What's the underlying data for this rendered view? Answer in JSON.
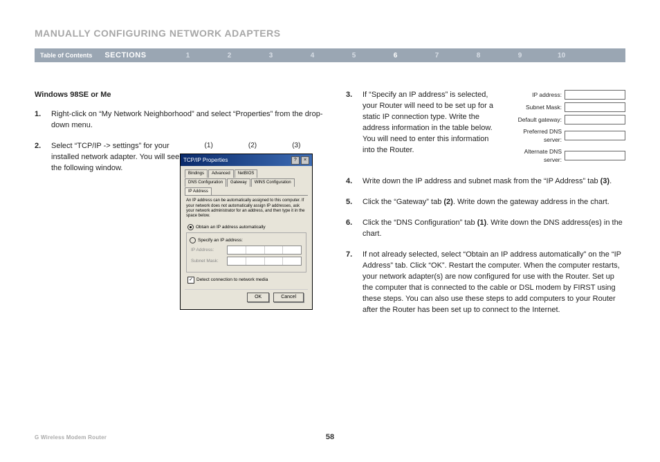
{
  "page": {
    "title": "MANUALLY CONFIGURING NETWORK ADAPTERS",
    "footer_left": "G Wireless Modem Router",
    "page_number": "58"
  },
  "nav": {
    "toc": "Table of Contents",
    "sections_label": "SECTIONS",
    "numbers": [
      "1",
      "2",
      "3",
      "4",
      "5",
      "6",
      "7",
      "8",
      "9",
      "10"
    ],
    "active": "6"
  },
  "subhead": "Windows 98SE or Me",
  "steps_left": {
    "1": "Right-click on “My Network Neighborhood” and select “Properties” from the drop-down menu.",
    "2": "Select “TCP/IP -> settings” for your installed network adapter. You will see the following window."
  },
  "markers": {
    "m1": "(1)",
    "m2": "(2)",
    "m3": "(3)"
  },
  "dialog": {
    "title": "TCP/IP Properties",
    "tabs_top": [
      "Bindings",
      "Advanced",
      "NetBIOS"
    ],
    "tabs_bottom": [
      "DNS Configuration",
      "Gateway",
      "WINS Configuration",
      "IP Address"
    ],
    "desc": "An IP address can be automatically assigned to this computer. If your network does not automatically assign IP addresses, ask your network administrator for an address, and then type it in the space below.",
    "radio_auto": "Obtain an IP address automatically",
    "radio_specify": "Specify an IP address:",
    "lbl_ip": "IP Address:",
    "lbl_mask": "Subnet Mask:",
    "chk_detect": "Detect connection to network media",
    "btn_ok": "OK",
    "btn_cancel": "Cancel"
  },
  "steps_right": {
    "3": "If “Specify an IP address” is selected, your Router will need to be set up for a static IP connection type. Write the address information in the table below. You will need to enter this information into the Router.",
    "4_pre": "Write down the IP address and subnet mask from the “IP Address” tab ",
    "4_bold": "(3)",
    "4_post": ".",
    "5_pre": "Click the “Gateway” tab ",
    "5_bold": "(2)",
    "5_post": ". Write down the gateway address in the chart.",
    "6_pre": "Click the “DNS Configuration” tab ",
    "6_bold": "(1)",
    "6_post": ". Write down the DNS address(es) in the chart.",
    "7": "If not already selected, select “Obtain an IP address automatically” on the “IP Address” tab. Click “OK”. Restart the computer. When the computer restarts, your network adapter(s) are now configured for use with the Router. Set up the computer that is connected to the cable or DSL modem by FIRST using these steps. You can also use these steps to add computers to your Router after the Router has been set up to connect to the Internet."
  },
  "addr_table": {
    "ip": "IP address:",
    "mask": "Subnet Mask:",
    "gateway": "Default gateway:",
    "dns1": "Preferred DNS server:",
    "dns2": "Alternate DNS server:"
  }
}
